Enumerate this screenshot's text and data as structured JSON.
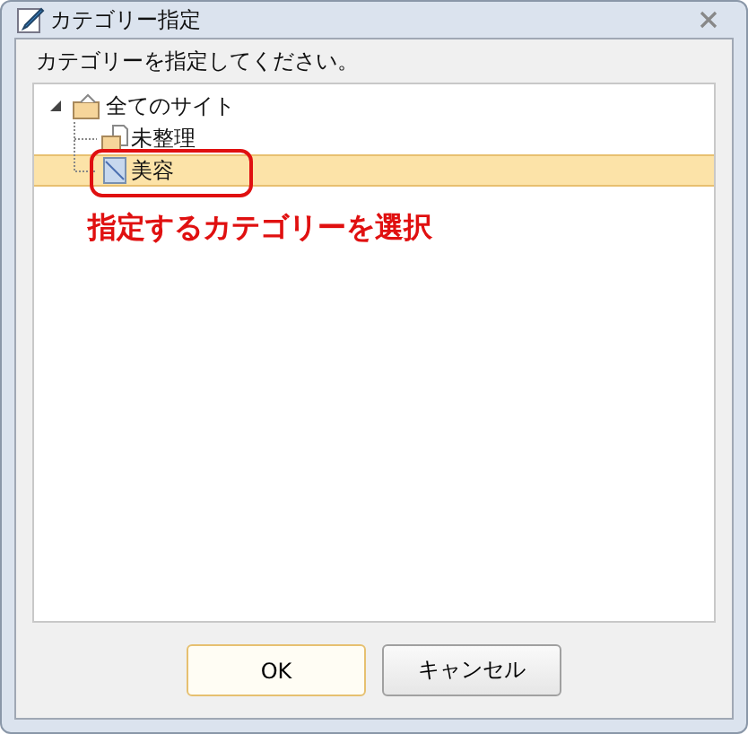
{
  "window": {
    "title": "カテゴリー指定"
  },
  "instruction": "カテゴリーを指定してください。",
  "tree": [
    {
      "label": "全てのサイト",
      "expanded": true,
      "selected": false,
      "kind": "root",
      "children": [
        {
          "label": "未整理",
          "selected": false,
          "kind": "folder"
        },
        {
          "label": "美容",
          "selected": true,
          "kind": "category"
        }
      ]
    }
  ],
  "annotation": {
    "text": "指定するカテゴリーを選択"
  },
  "buttons": [
    {
      "label": "OK",
      "default": true
    },
    {
      "label": "キャンセル",
      "default": false
    }
  ]
}
